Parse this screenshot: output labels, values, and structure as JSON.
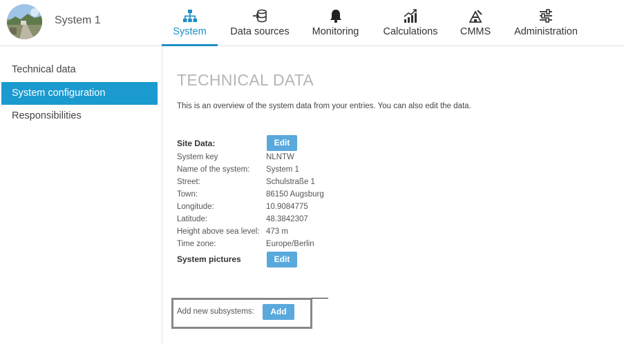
{
  "header": {
    "system_name": "System 1",
    "avatar_icon": "site-photo-avatar",
    "accent_color": "#1b8fc4",
    "nav": [
      {
        "label": "System",
        "icon": "sitemap-icon",
        "active": true
      },
      {
        "label": "Data sources",
        "icon": "database-import-icon",
        "active": false
      },
      {
        "label": "Monitoring",
        "icon": "bell-icon",
        "active": false
      },
      {
        "label": "Calculations",
        "icon": "chart-trend-icon",
        "active": false
      },
      {
        "label": "CMMS",
        "icon": "maintenance-icon",
        "active": false
      },
      {
        "label": "Administration",
        "icon": "sliders-icon",
        "active": false
      }
    ]
  },
  "sidebar": {
    "items": [
      {
        "label": "Technical data",
        "active": false
      },
      {
        "label": "System configuration",
        "active": true
      },
      {
        "label": "Responsibilities",
        "active": false
      }
    ]
  },
  "main": {
    "title": "TECHNICAL DATA",
    "intro": "This is an overview of the system data from your entries. You can also edit the data.",
    "site_data_label": "Site Data:",
    "edit_label": "Edit",
    "fields": [
      {
        "key": "System key",
        "value": "NLNTW"
      },
      {
        "key": "Name of the system:",
        "value": "System 1"
      },
      {
        "key": "Street:",
        "value": "Schulstraße 1"
      },
      {
        "key": "Town:",
        "value": "86150 Augsburg"
      },
      {
        "key": "Longitude:",
        "value": "10.9084775"
      },
      {
        "key": "Latitude:",
        "value": "48.3842307"
      },
      {
        "key": "Height above sea level:",
        "value": "473 m"
      },
      {
        "key": "Time zone:",
        "value": "Europe/Berlin"
      }
    ],
    "pictures_label": "System pictures",
    "pictures_edit_label": "Edit",
    "subsystems_label": "Add new subsystems:",
    "add_label": "Add"
  }
}
